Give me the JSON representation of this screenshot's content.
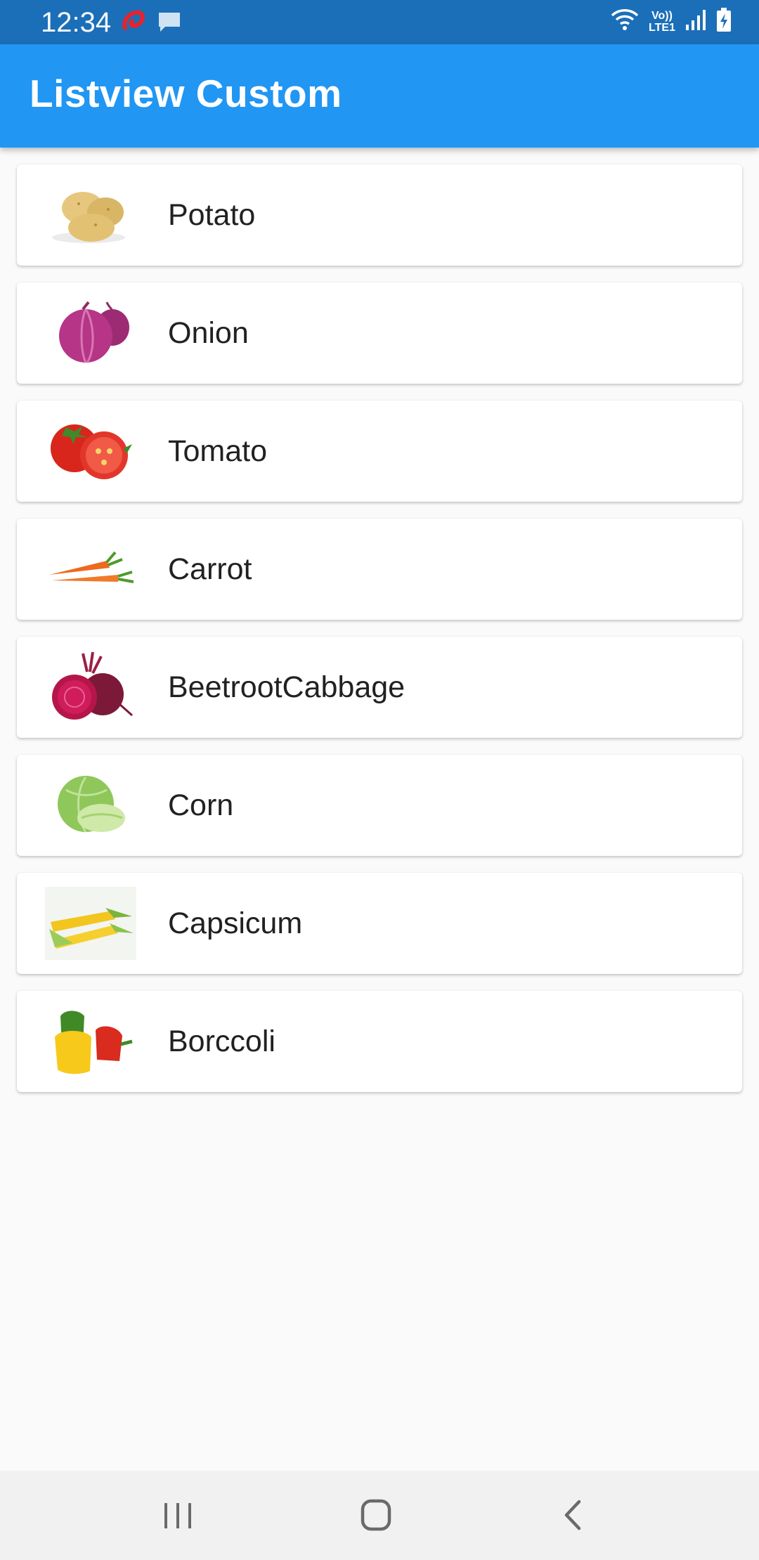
{
  "status": {
    "time": "12:34",
    "network": "Vo)) LTE1"
  },
  "app_bar": {
    "title": "Listview Custom"
  },
  "items": [
    {
      "name": "Potato",
      "image": "potato-image"
    },
    {
      "name": "Onion",
      "image": "onion-image"
    },
    {
      "name": "Tomato",
      "image": "tomato-image"
    },
    {
      "name": "Carrot",
      "image": "carrot-image"
    },
    {
      "name": "BeetrootCabbage",
      "image": "beetroot-image"
    },
    {
      "name": "Corn",
      "image": "cabbage-image"
    },
    {
      "name": "Capsicum",
      "image": "corn-image"
    },
    {
      "name": "Borccoli",
      "image": "capsicum-image"
    }
  ],
  "nav": {
    "recent": "recent-apps-icon",
    "home": "home-icon",
    "back": "back-icon"
  },
  "colors": {
    "status_bar": "#1b6fb8",
    "app_bar": "#2196f3",
    "background": "#fafafa",
    "card": "#ffffff"
  }
}
